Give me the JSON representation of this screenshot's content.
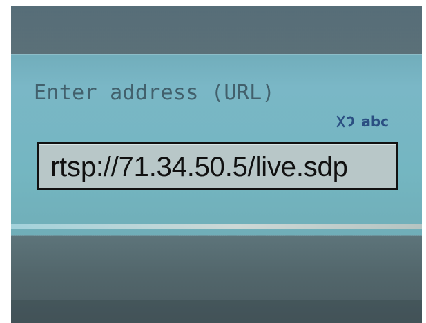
{
  "dialog": {
    "title": "Enter address (URL)",
    "input_mode": "abc",
    "url_value": "rtsp://71.34.50.5/live.sdp"
  },
  "colors": {
    "screen_blue": "#77b6c4",
    "label_blue": "#42606c",
    "mode_blue": "#2b4f82",
    "field_bg": "#b8c7c8"
  },
  "icons": {
    "input_mode": "text-input-mode-icon"
  }
}
